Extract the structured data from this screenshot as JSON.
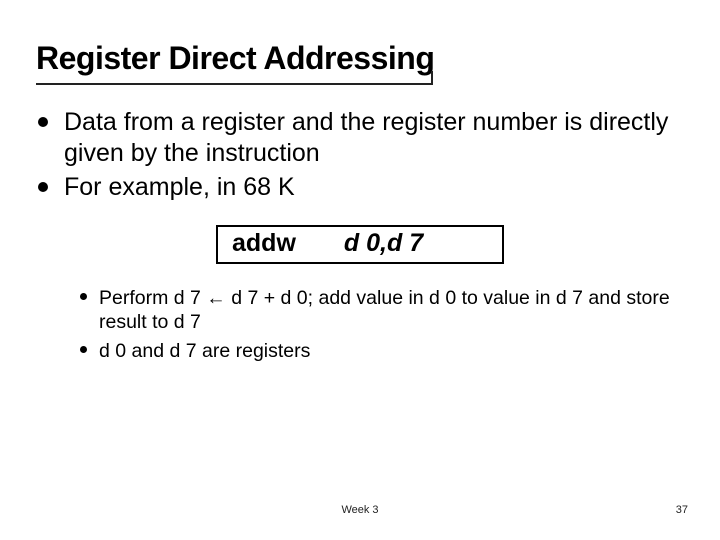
{
  "title": "Register Direct Addressing",
  "bullets": [
    "Data from a register and the register number is directly given by the instruction",
    "For example, in 68 K"
  ],
  "code": {
    "mnemonic": "addw",
    "op1": "d 0",
    "sep": ",",
    "op2": "d 7"
  },
  "sub_bullets": [
    "Perform d 7 ← d 7 + d 0; add value in d 0 to value in d 7 and store result to d 7",
    "d 0 and d 7 are registers"
  ],
  "footer": {
    "center": "Week 3",
    "page": "37"
  }
}
